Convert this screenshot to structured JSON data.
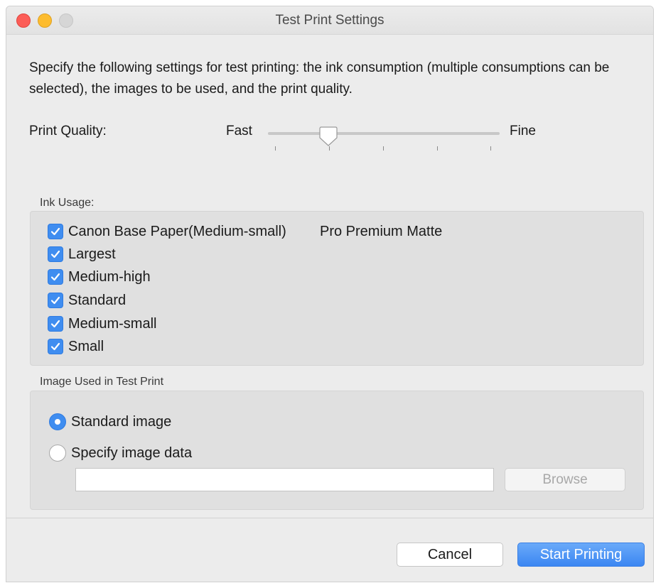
{
  "window": {
    "title": "Test Print Settings"
  },
  "description": "Specify the following settings for test printing: the ink consumption (multiple consumptions can be selected), the images to be used, and the print quality.",
  "print_quality": {
    "label": "Print Quality:",
    "min_label": "Fast",
    "max_label": "Fine",
    "value_fraction": 0.26,
    "tick_count": 5
  },
  "ink_usage": {
    "label": "Ink Usage:",
    "media_name": "Pro Premium Matte",
    "items": [
      {
        "label": "Canon Base Paper(Medium-small)",
        "checked": true
      },
      {
        "label": "Largest",
        "checked": true
      },
      {
        "label": "Medium-high",
        "checked": true
      },
      {
        "label": "Standard",
        "checked": true
      },
      {
        "label": "Medium-small",
        "checked": true
      },
      {
        "label": "Small",
        "checked": true
      }
    ]
  },
  "image_used": {
    "label": "Image Used in Test Print",
    "options": [
      {
        "label": "Standard image",
        "selected": true
      },
      {
        "label": "Specify image data",
        "selected": false
      }
    ],
    "path_value": "",
    "browse_label": "Browse"
  },
  "buttons": {
    "cancel": "Cancel",
    "start": "Start Printing"
  },
  "colors": {
    "accent": "#3f8df0",
    "close": "#fc5d57",
    "minimize": "#fdbc2e"
  }
}
